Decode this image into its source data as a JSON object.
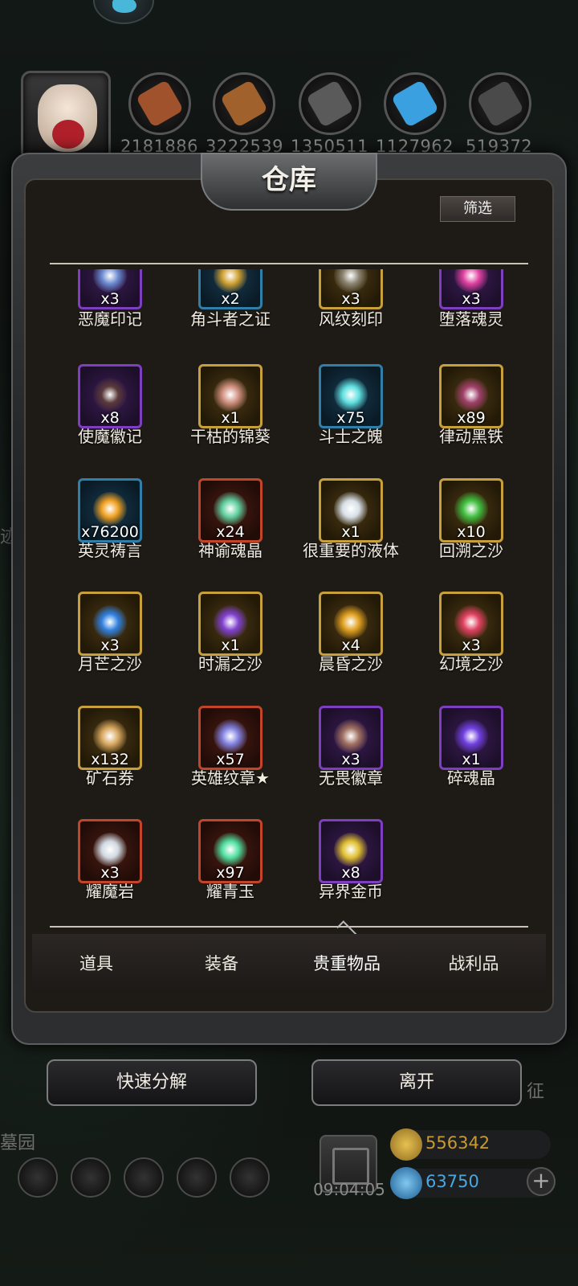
{
  "resources": [
    {
      "icon": "wood-log-icon",
      "value": "2181886",
      "color": "#a0522d"
    },
    {
      "icon": "plank-icon",
      "value": "3222539",
      "color": "#a0612d"
    },
    {
      "icon": "iron-ingot-icon",
      "value": "1350511",
      "color": "#5a5a5a"
    },
    {
      "icon": "crystal-icon",
      "value": "1127962",
      "color": "#3aa0e0"
    },
    {
      "icon": "dark-ingot-icon",
      "value": "519372",
      "color": "#4a4a4a"
    }
  ],
  "panel": {
    "title": "仓库",
    "filter_label": "筛选"
  },
  "items": [
    {
      "name": "恶魔印记",
      "qty": "x3",
      "rarity": "purple",
      "icon_color": "#6a8ad0"
    },
    {
      "name": "角斗者之证",
      "qty": "x2",
      "rarity": "blue",
      "icon_color": "#d0a030"
    },
    {
      "name": "风纹刻印",
      "qty": "x3",
      "rarity": "gold",
      "icon_color": "#8a8470"
    },
    {
      "name": "堕落魂灵",
      "qty": "x3",
      "rarity": "purple",
      "icon_color": "#e040a0"
    },
    {
      "name": "使魔徽记",
      "qty": "x8",
      "rarity": "purple",
      "icon_color": "#5a3a3a"
    },
    {
      "name": "干枯的锦葵",
      "qty": "x1",
      "rarity": "gold",
      "icon_color": "#d09080"
    },
    {
      "name": "斗士之魄",
      "qty": "x75",
      "rarity": "blue",
      "icon_color": "#60e0e0"
    },
    {
      "name": "律动黑铁",
      "qty": "x89",
      "rarity": "gold",
      "icon_color": "#a0406a"
    },
    {
      "name": "英灵祷言",
      "qty": "x76200",
      "rarity": "blue",
      "icon_color": "#f0a020"
    },
    {
      "name": "神谕魂晶",
      "qty": "x24",
      "rarity": "red",
      "icon_color": "#60d0a0"
    },
    {
      "name": "很重要的液体",
      "qty": "x1",
      "rarity": "gold",
      "icon_color": "#d8e0e8"
    },
    {
      "name": "回溯之沙",
      "qty": "x10",
      "rarity": "gold",
      "icon_color": "#40c040"
    },
    {
      "name": "月芒之沙",
      "qty": "x3",
      "rarity": "gold",
      "icon_color": "#3080e0"
    },
    {
      "name": "时漏之沙",
      "qty": "x1",
      "rarity": "gold",
      "icon_color": "#8040d0"
    },
    {
      "name": "晨昏之沙",
      "qty": "x4",
      "rarity": "gold",
      "icon_color": "#e0a020"
    },
    {
      "name": "幻境之沙",
      "qty": "x3",
      "rarity": "gold",
      "icon_color": "#e04060"
    },
    {
      "name": "矿石券",
      "qty": "x132",
      "rarity": "gold",
      "icon_color": "#d8a860"
    },
    {
      "name": "英雄纹章★",
      "qty": "x57",
      "rarity": "red",
      "icon_color": "#8080e0"
    },
    {
      "name": "无畏徽章",
      "qty": "x3",
      "rarity": "purple",
      "icon_color": "#a07060"
    },
    {
      "name": "碎魂晶",
      "qty": "x1",
      "rarity": "purple",
      "icon_color": "#7040e0"
    },
    {
      "name": "耀魔岩",
      "qty": "x3",
      "rarity": "red",
      "icon_color": "#d0d8e0"
    },
    {
      "name": "耀青玉",
      "qty": "x97",
      "rarity": "red",
      "icon_color": "#50e0a0"
    },
    {
      "name": "异界金币",
      "qty": "x8",
      "rarity": "purple",
      "icon_color": "#e0c030"
    }
  ],
  "tabs": [
    {
      "label": "道具"
    },
    {
      "label": "装备"
    },
    {
      "label": "贵重物品",
      "active": true
    },
    {
      "label": "战利品"
    }
  ],
  "actions": {
    "quick_decompose": "快速分解",
    "leave": "离开"
  },
  "background": {
    "left_text_1": "墓园",
    "right_text_1": "征",
    "left_text_2": "迹"
  },
  "footer": {
    "timer": "09:04:05",
    "gold": "556342",
    "gems": "63750"
  },
  "colors": {
    "purple": "#7d3ec0",
    "gold": "#c7a03c",
    "blue": "#2f7fa8",
    "red": "#c2452a",
    "gold_text": "#c89a30",
    "gem_text": "#4aa8e0"
  }
}
